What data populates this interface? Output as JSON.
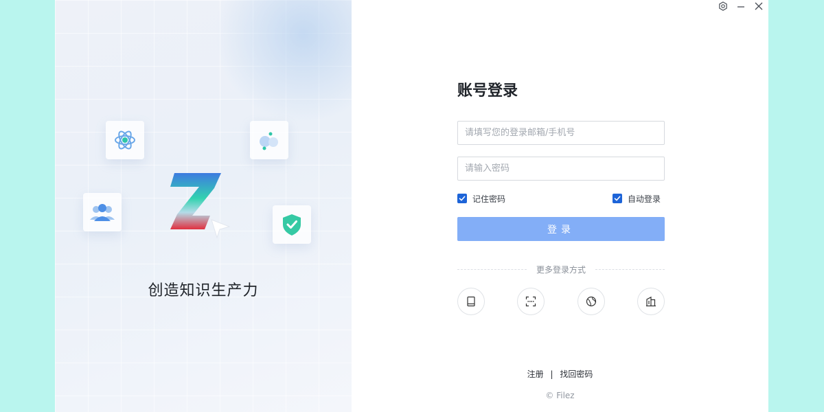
{
  "brand": {
    "slogan": "创造知识生产力",
    "icons": [
      "atom-icon",
      "cloud-icon",
      "user-group-icon",
      "shield-check-icon",
      "z-logo"
    ],
    "colors": {
      "accent": "#83aef7",
      "checkbox": "#1d64d8",
      "background": "#b9f5ee"
    }
  },
  "window": {
    "controls": [
      "settings-icon",
      "minimize-icon",
      "close-icon"
    ]
  },
  "login": {
    "title": "账号登录",
    "username_placeholder": "请填写您的登录邮箱/手机号",
    "password_placeholder": "请输入密码",
    "remember_label": "记住密码",
    "remember_checked": true,
    "auto_login_label": "自动登录",
    "auto_login_checked": true,
    "submit_label": "登录",
    "more_methods_label": "更多登录方式",
    "methods": [
      "tablet-icon",
      "scan-icon",
      "globe-icon",
      "building-icon"
    ]
  },
  "footer": {
    "register_label": "注册",
    "separator": "|",
    "forgot_label": "找回密码",
    "copyright": "© Filez"
  }
}
